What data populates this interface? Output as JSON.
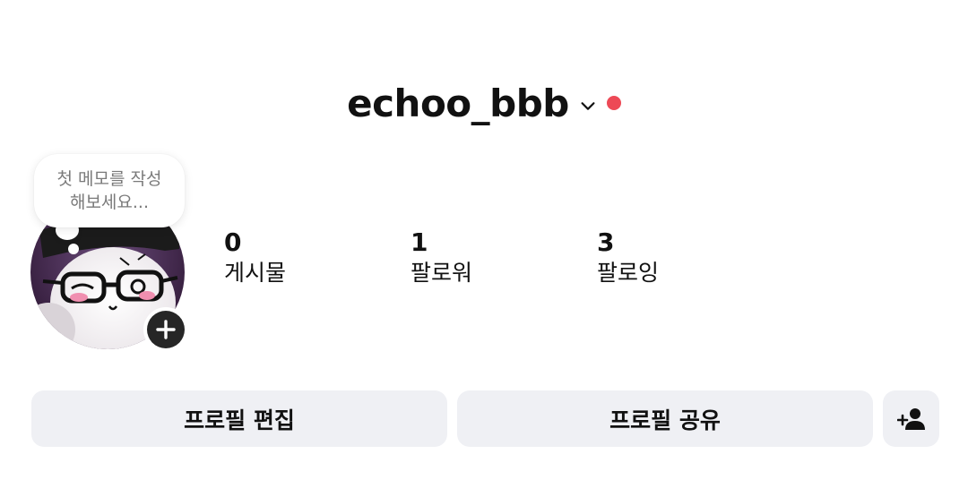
{
  "header": {
    "username": "echoo_bbb",
    "chevron_icon": "chevron-down-icon",
    "notification_dot_color": "#ed4956"
  },
  "note": {
    "placeholder": "첫 메모를 작성\n해보세요..."
  },
  "avatar": {
    "add_icon": "plus-icon"
  },
  "stats": [
    {
      "value": "0",
      "label": "게시물"
    },
    {
      "value": "1",
      "label": "팔로워"
    },
    {
      "value": "3",
      "label": "팔로잉"
    }
  ],
  "actions": {
    "edit_profile": "프로필 편집",
    "share_profile": "프로필 공유",
    "discover_people_icon": "person-add-icon"
  },
  "colors": {
    "button_bg": "#eff0f4",
    "text": "#111111"
  }
}
